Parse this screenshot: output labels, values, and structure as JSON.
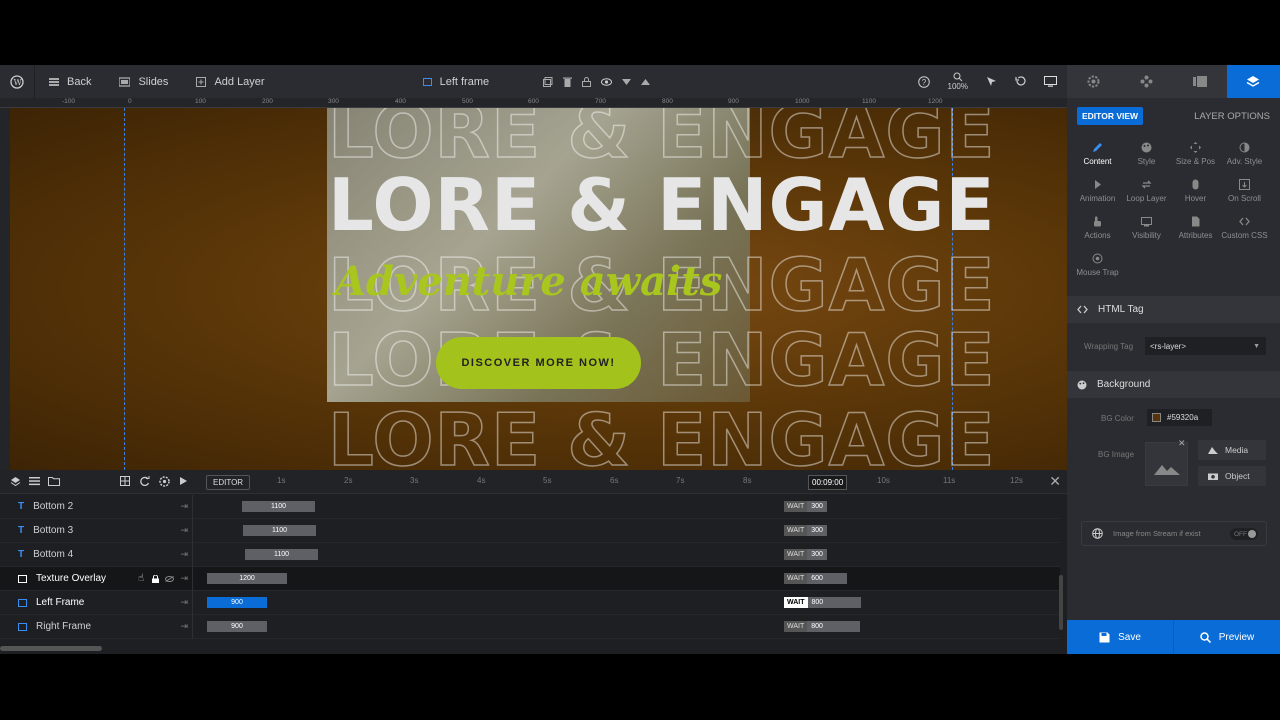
{
  "toolbar": {
    "back": "Back",
    "slides": "Slides",
    "add_layer": "Add Layer",
    "layer_name": "Left frame",
    "zoom": "100%"
  },
  "ruler": [
    "-100",
    "0",
    "100",
    "200",
    "300",
    "400",
    "500",
    "600",
    "700",
    "800",
    "900",
    "1000",
    "1100",
    "1200"
  ],
  "canvas": {
    "headline": "LORE & ENGAGE",
    "slogan": "Adventure awaits",
    "cta": "DISCOVER MORE NOW!"
  },
  "timeline": {
    "editor_label": "EDITOR",
    "seconds": [
      "1s",
      "2s",
      "3s",
      "4s",
      "5s",
      "6s",
      "7s",
      "8s",
      "9s",
      "10s",
      "11s",
      "12s"
    ],
    "current_time": "00:09:00",
    "rows": [
      {
        "name": "Bottom 2",
        "duration": "1100",
        "wait": "WAIT",
        "wait_value": "300"
      },
      {
        "name": "Bottom 3",
        "duration": "1100",
        "wait": "WAIT",
        "wait_value": "300"
      },
      {
        "name": "Bottom 4",
        "duration": "1100",
        "wait": "WAIT",
        "wait_value": "300"
      },
      {
        "name": "Texture Overlay",
        "duration": "1200",
        "wait": "WAIT",
        "wait_value": "600"
      },
      {
        "name": "Left Frame",
        "duration": "900",
        "wait": "WAIT",
        "wait_value": "800"
      },
      {
        "name": "Right Frame",
        "duration": "900",
        "wait": "WAIT",
        "wait_value": "800"
      }
    ]
  },
  "panel": {
    "editor_view": "EDITOR VIEW",
    "layer_options": "LAYER OPTIONS",
    "options": [
      "Content",
      "Style",
      "Size & Pos",
      "Adv. Style",
      "Animation",
      "Loop Layer",
      "Hover",
      "On Scroll",
      "Actions",
      "Visibility",
      "Attributes",
      "Custom CSS",
      "Mouse Trap"
    ],
    "html_tag_title": "HTML Tag",
    "wrapping_tag_label": "Wrapping Tag",
    "wrapping_tag_value": "<rs-layer>",
    "background_title": "Background",
    "bg_color_label": "BG Color",
    "bg_color_value": "#59320a",
    "bg_image_label": "BG Image",
    "media_button": "Media",
    "object_button": "Object",
    "stream_label": "Image from Stream if exist",
    "stream_toggle": "OFF"
  },
  "footer": {
    "save": "Save",
    "preview": "Preview"
  },
  "colors": {
    "accent": "#0a6cd6",
    "cta": "#a3c31c",
    "bg": "#59320a"
  }
}
